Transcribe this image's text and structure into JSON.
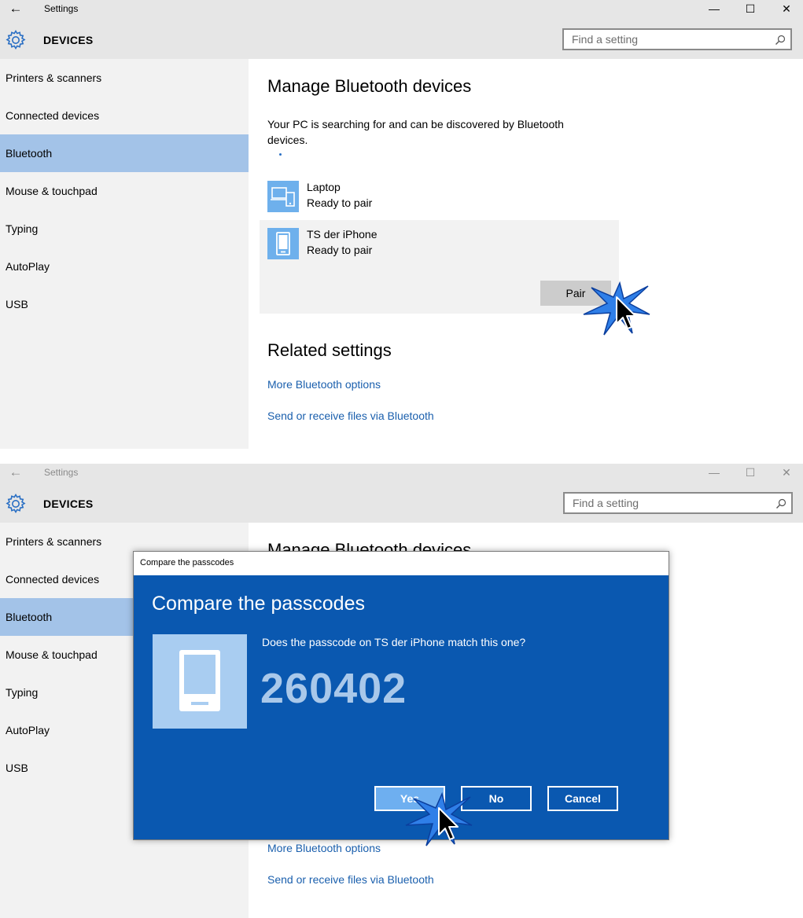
{
  "window": {
    "title": "Settings",
    "back_glyph": "←",
    "minimize_glyph": "—",
    "maximize_glyph": "☐",
    "close_glyph": "✕"
  },
  "header": {
    "section": "DEVICES",
    "search_placeholder": "Find a setting",
    "settings_icon": "gear-icon",
    "search_icon": "search-icon"
  },
  "sidebar": {
    "items": [
      {
        "label": "Printers & scanners"
      },
      {
        "label": "Connected devices"
      },
      {
        "label": "Bluetooth",
        "selected": true
      },
      {
        "label": "Mouse & touchpad"
      },
      {
        "label": "Typing"
      },
      {
        "label": "AutoPlay"
      },
      {
        "label": "USB"
      }
    ]
  },
  "main": {
    "title": "Manage Bluetooth devices",
    "description": "Your PC is searching for and can be discovered by Bluetooth devices.",
    "devices": [
      {
        "name": "Laptop",
        "status": "Ready to pair",
        "icon": "laptop-phone-icon"
      },
      {
        "name": "TS der iPhone",
        "status": "Ready to pair",
        "icon": "phone-icon",
        "selected": true
      }
    ],
    "pair_label": "Pair",
    "related_title": "Related settings",
    "links": [
      "More Bluetooth options",
      "Send or receive files via Bluetooth"
    ]
  },
  "dialog": {
    "window_title": "Compare the passcodes",
    "heading": "Compare the passcodes",
    "question": "Does the passcode on TS der iPhone match this one?",
    "passcode": "260402",
    "buttons": {
      "yes": "Yes",
      "no": "No",
      "cancel": "Cancel"
    },
    "icon": "phone-icon"
  },
  "colors": {
    "accent": "#0a58b0",
    "selected_nav": "#a3c3e8",
    "link": "#1a5fad",
    "titlebar": "#e6e6e6",
    "sidebar": "#f2f2f2"
  }
}
